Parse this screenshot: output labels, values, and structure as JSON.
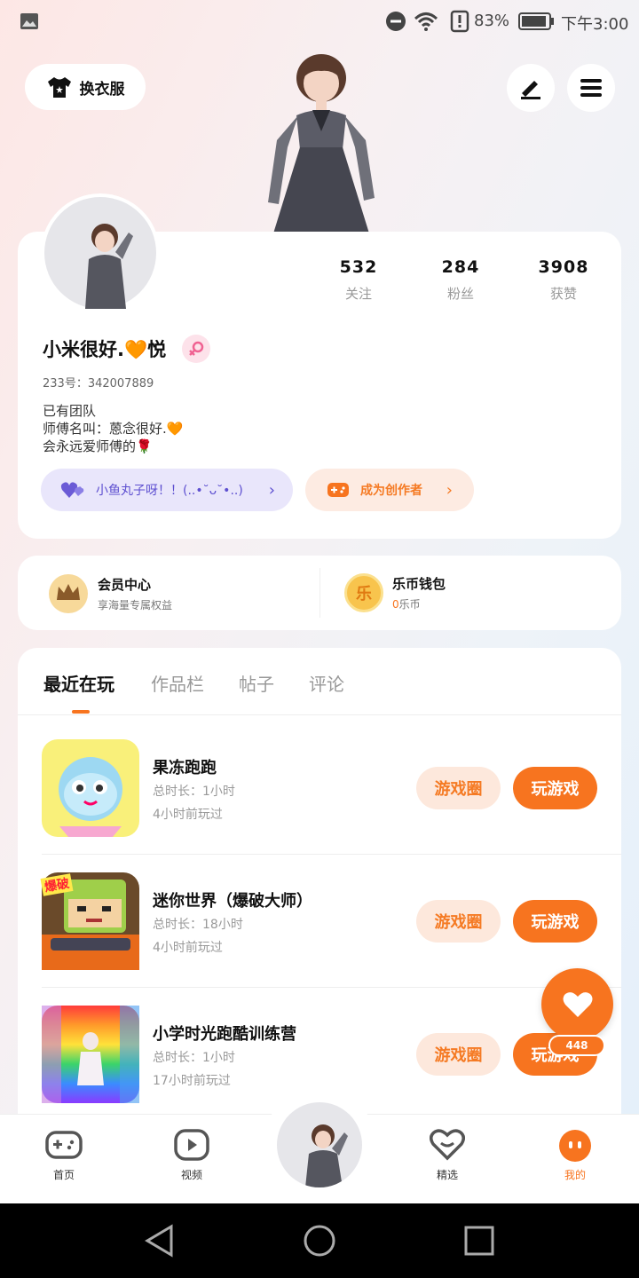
{
  "status_bar": {
    "battery": "83%",
    "time": "下午3:00"
  },
  "top": {
    "change_clothes": "换衣服"
  },
  "stats": [
    {
      "num": "532",
      "label": "关注"
    },
    {
      "num": "284",
      "label": "粉丝"
    },
    {
      "num": "3908",
      "label": "获赞"
    }
  ],
  "profile": {
    "name": "小米很好.🧡悦",
    "id": "233号：342007889",
    "bio1": "已有团队",
    "bio2": "师傅名叫：蒽念很好.🧡",
    "bio3": "会永远爱师傅的🌹",
    "team_chip": "小鱼丸子呀！！(..•˘ᴗ˘•..)",
    "creator_chip": "成为创作者"
  },
  "member": {
    "title": "会员中心",
    "sub": "享海量专属权益"
  },
  "wallet": {
    "title": "乐币钱包",
    "amount": "0",
    "unit": "乐币",
    "coin": "乐"
  },
  "tabs": [
    "最近在玩",
    "作品栏",
    "帖子",
    "评论"
  ],
  "games": [
    {
      "title": "果冻跑跑",
      "duration": "总时长：1小时",
      "last": "4小时前玩过"
    },
    {
      "title": "迷你世界（爆破大师）",
      "duration": "总时长：18小时",
      "last": "4小时前玩过"
    },
    {
      "title": "小学时光跑酷训练营",
      "duration": "总时长：1小时",
      "last": "17小时前玩过"
    }
  ],
  "game_buttons": {
    "circle": "游戏圈",
    "play": "玩游戏"
  },
  "game2_badge": "爆破",
  "like_count": "448",
  "nav": {
    "home": "首页",
    "video": "视频",
    "featured": "精选",
    "mine": "我的"
  },
  "colors": {
    "accent": "#f7741f",
    "accent_light": "#fde8dc",
    "purple": "#6b5bd6"
  }
}
